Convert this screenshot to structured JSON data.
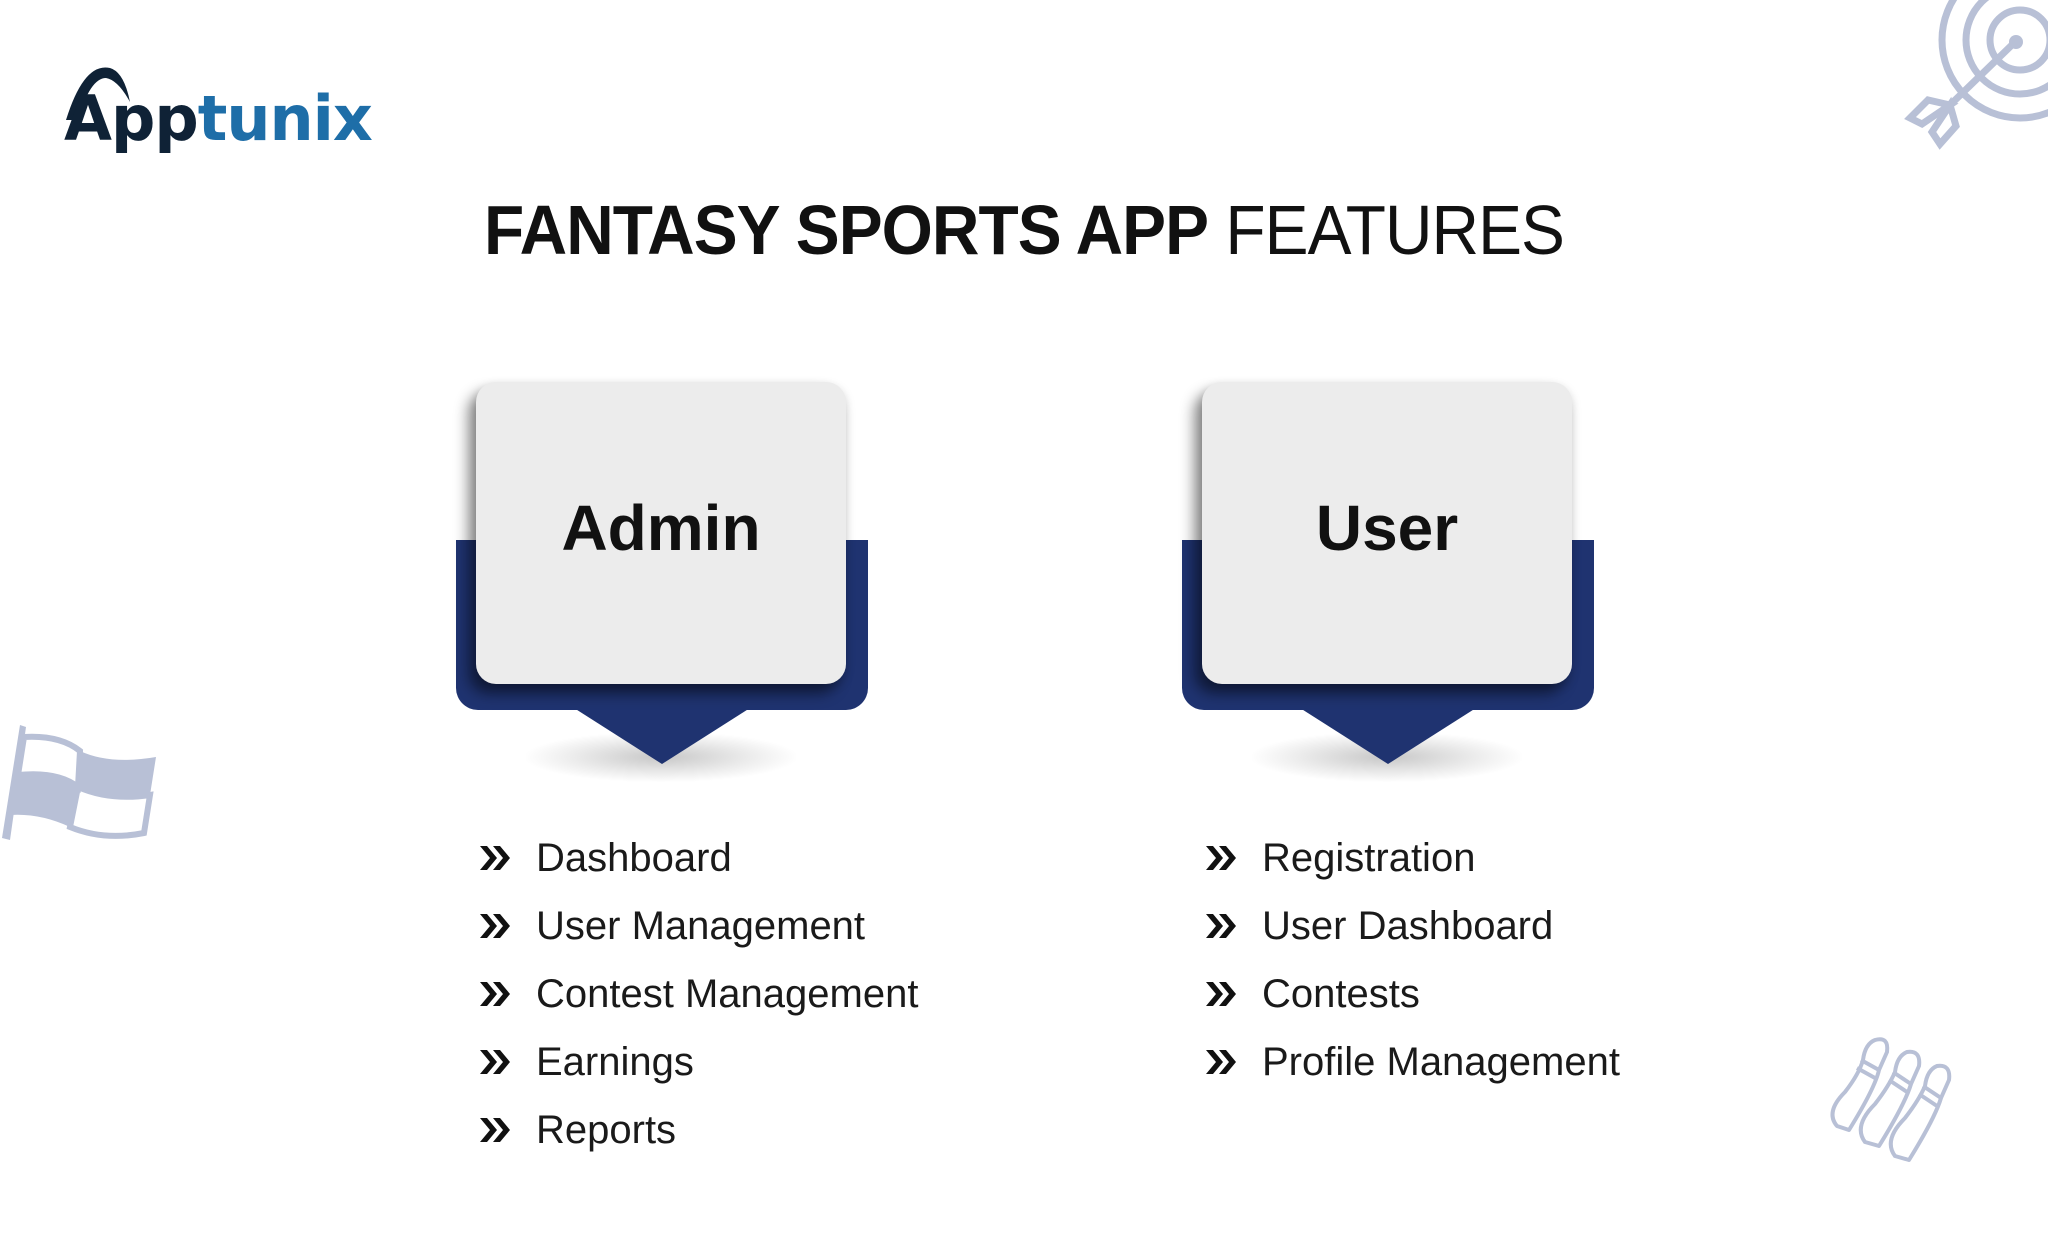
{
  "brand": {
    "logo_part1": "App",
    "logo_part2": "tunix",
    "primary_color": "#0f2236",
    "accent_color": "#1e6ea8"
  },
  "header": {
    "title_bold": "FANTASY SPORTS APP",
    "title_light": "FEATURES"
  },
  "theme": {
    "card_navy": "#1f3370",
    "card_face": "#ececec",
    "decor_color": "#b8c0d6"
  },
  "sections": [
    {
      "label": "Admin",
      "items": [
        "Dashboard",
        "User Management",
        "Contest Management",
        "Earnings",
        "Reports"
      ]
    },
    {
      "label": "User",
      "items": [
        "Registration",
        "User Dashboard",
        "Contests",
        "Profile Management"
      ]
    }
  ],
  "decorations": [
    "target-arrow-icon",
    "checkered-flag-icon",
    "bowling-pins-icon"
  ]
}
